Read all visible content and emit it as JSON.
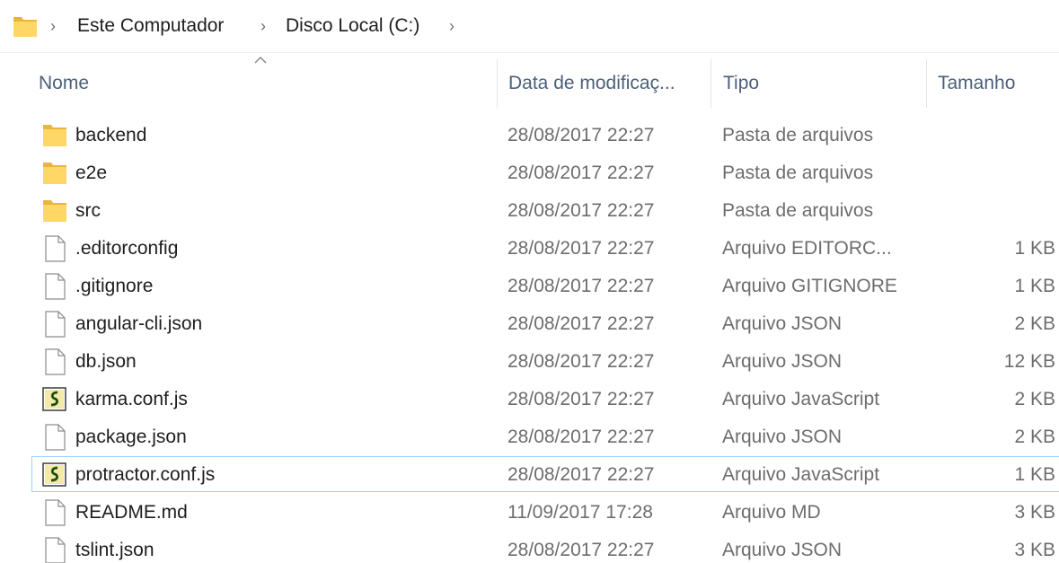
{
  "breadcrumb": {
    "items": [
      "Este Computador",
      "Disco Local (C:)"
    ]
  },
  "columns": {
    "name": "Nome",
    "date": "Data de modificaç...",
    "type": "Tipo",
    "size": "Tamanho"
  },
  "colors": {
    "folder": "#ffd766",
    "folder_dark": "#e8b53e",
    "selection_border": "#99d1ff",
    "header_text": "#4c607a",
    "secondary_text": "#6d6d6d"
  },
  "files": [
    {
      "name": "backend",
      "date": "28/08/2017 22:27",
      "type": "Pasta de arquivos",
      "size": "",
      "icon": "folder-icon"
    },
    {
      "name": "e2e",
      "date": "28/08/2017 22:27",
      "type": "Pasta de arquivos",
      "size": "",
      "icon": "folder-icon"
    },
    {
      "name": "src",
      "date": "28/08/2017 22:27",
      "type": "Pasta de arquivos",
      "size": "",
      "icon": "folder-icon"
    },
    {
      "name": ".editorconfig",
      "date": "28/08/2017 22:27",
      "type": "Arquivo EDITORC...",
      "size": "1 KB",
      "icon": "file-icon"
    },
    {
      "name": ".gitignore",
      "date": "28/08/2017 22:27",
      "type": "Arquivo GITIGNORE",
      "size": "1 KB",
      "icon": "file-icon"
    },
    {
      "name": "angular-cli.json",
      "date": "28/08/2017 22:27",
      "type": "Arquivo JSON",
      "size": "2 KB",
      "icon": "file-icon"
    },
    {
      "name": "db.json",
      "date": "28/08/2017 22:27",
      "type": "Arquivo JSON",
      "size": "12 KB",
      "icon": "file-icon"
    },
    {
      "name": "karma.conf.js",
      "date": "28/08/2017 22:27",
      "type": "Arquivo JavaScript",
      "size": "2 KB",
      "icon": "script-icon"
    },
    {
      "name": "package.json",
      "date": "28/08/2017 22:27",
      "type": "Arquivo JSON",
      "size": "2 KB",
      "icon": "file-icon"
    },
    {
      "name": "protractor.conf.js",
      "date": "28/08/2017 22:27",
      "type": "Arquivo JavaScript",
      "size": "1 KB",
      "icon": "script-icon",
      "selected": true
    },
    {
      "name": "README.md",
      "date": "11/09/2017 17:28",
      "type": "Arquivo MD",
      "size": "3 KB",
      "icon": "file-icon"
    },
    {
      "name": "tslint.json",
      "date": "28/08/2017 22:27",
      "type": "Arquivo JSON",
      "size": "3 KB",
      "icon": "file-icon"
    }
  ]
}
